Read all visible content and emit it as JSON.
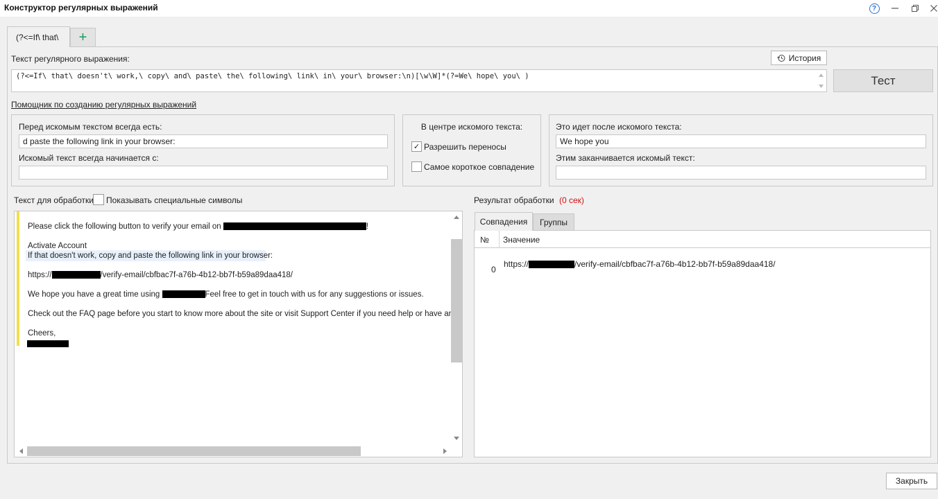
{
  "window": {
    "title": "Конструктор регулярных выражений"
  },
  "tabs": {
    "active_label": "(?<=If\\ that\\",
    "add_label": "+"
  },
  "regex": {
    "label": "Текст регулярного выражения:",
    "history_label": "История",
    "value": "(?<=If\\ that\\ doesn't\\ work,\\ copy\\ and\\ paste\\ the\\ following\\ link\\ in\\ your\\ browser:\\n)[\\w\\W]*(?=We\\ hope\\ you\\ )",
    "test_label": "Тест"
  },
  "helper": {
    "link": "Помощник по созданию регулярных выражений",
    "before": {
      "label": "Перед искомым текстом всегда есть:",
      "value": "d paste the following link in your browser:",
      "starts_label": "Искомый текст всегда начинается с:",
      "starts_value": ""
    },
    "center": {
      "label": "В центре искомого текста:",
      "wrap_label": "Разрешить переносы",
      "wrap_checked": true,
      "shortest_label": "Самое короткое совпадение",
      "shortest_checked": false
    },
    "after": {
      "label": "Это идет после искомого текста:",
      "value": "We hope you",
      "ends_label": "Этим заканчивается искомый текст:",
      "ends_value": ""
    }
  },
  "source": {
    "label": "Текст для обработки",
    "special_label": "Показывать специальные символы",
    "lines": {
      "l1a": "Please click the following button to verify your email on ",
      "l1b": "!",
      "l2": "Activate Account",
      "l3": "If that doesn't work, copy and paste the following link in your browser:",
      "l4a": "https://",
      "l4b": "/verify-email/cbfbac7f-a76b-4b12-bb7f-b59a89daa418/",
      "l5a": "We hope you have a great time using ",
      "l5b": "Feel free to get in touch with us for any suggestions or issues.",
      "l6": "Check out the FAQ page before you start to know more about the site or visit Support Center if you need help or have any sug",
      "l7": "Cheers,"
    }
  },
  "result": {
    "label": "Результат обработки",
    "time": "(0 сек)",
    "tab_matches": "Совпадения",
    "tab_groups": "Группы",
    "col_num": "№",
    "col_value": "Значение",
    "rows": [
      {
        "num": "0",
        "value_a": "https://",
        "value_b": "/verify-email/cbfbac7f-a76b-4b12-bb7f-b59a89daa418/"
      }
    ]
  },
  "footer": {
    "close_label": "Закрыть"
  },
  "colors": {
    "highlight_bar": "#f2e04a",
    "highlight_line": "#e8f1fb",
    "time_red": "#d01010",
    "add_green": "#1a9a5a"
  }
}
